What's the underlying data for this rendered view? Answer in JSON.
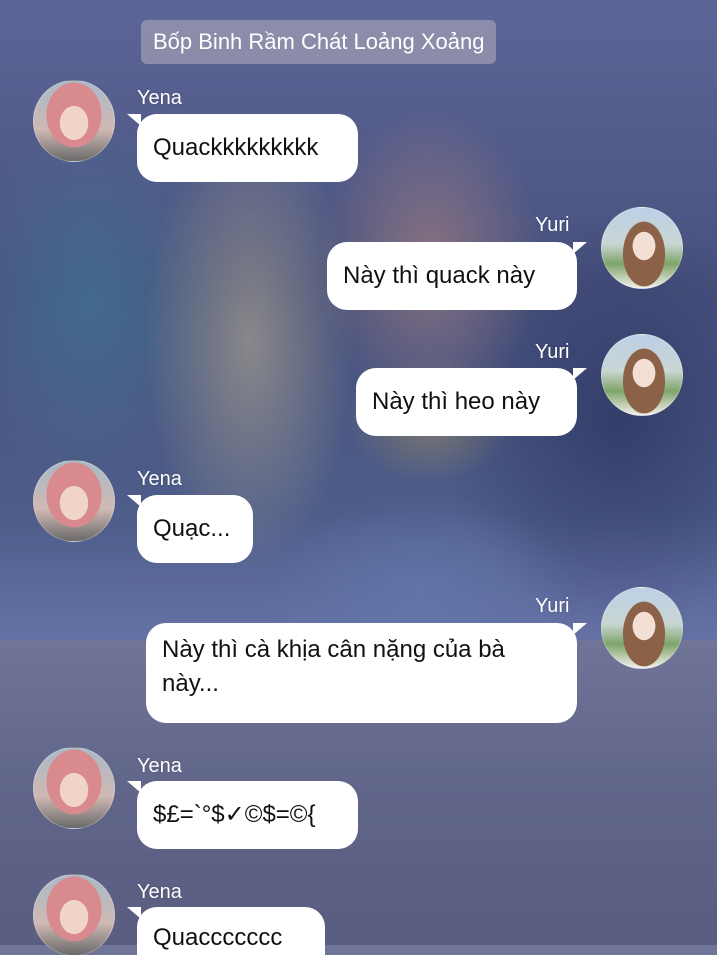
{
  "chat": {
    "title": "Bốp Binh Rầm Chát Loảng Xoảng",
    "messages": [
      {
        "sender": "Yena",
        "side": "left",
        "text": "Quackkkkkkkkk"
      },
      {
        "sender": "Yuri",
        "side": "right",
        "text": "Này thì quack này"
      },
      {
        "sender": "Yuri",
        "side": "right",
        "text": "Này thì heo này"
      },
      {
        "sender": "Yena",
        "side": "left",
        "text": "Quạc..."
      },
      {
        "sender": "Yuri",
        "side": "right",
        "text": "Này thì cà khịa cân nặng của bà này..."
      },
      {
        "sender": "Yena",
        "side": "left",
        "text": "$£=`°$✓©$=©{"
      },
      {
        "sender": "Yena",
        "side": "left",
        "text": "Quaccccccc"
      }
    ]
  },
  "colors": {
    "bubble": "#ffffff",
    "title_pill": "#9696af",
    "text": "#111111",
    "name": "#ffffff"
  },
  "avatars": {
    "yena": "avatar-yena",
    "yuri": "avatar-yuri"
  }
}
